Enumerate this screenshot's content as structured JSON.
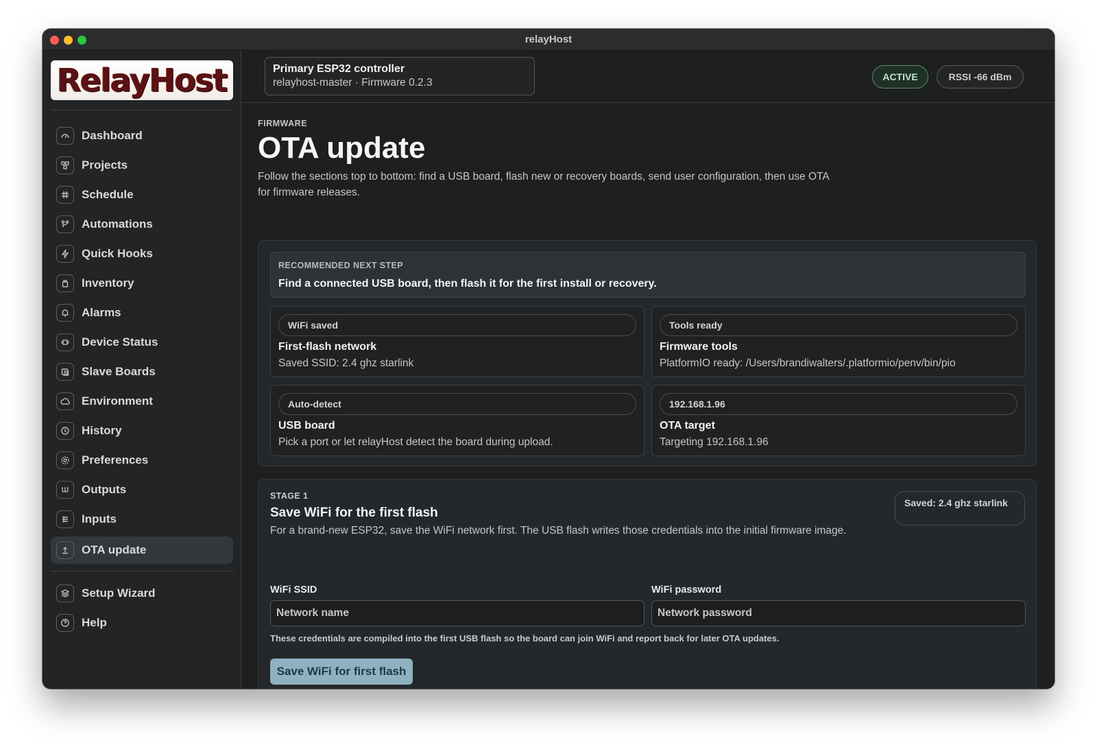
{
  "window": {
    "title": "relayHost"
  },
  "brand": {
    "logo_text": "RelayHost"
  },
  "sidebar": {
    "items": [
      {
        "label": "Dashboard",
        "icon": "gauge-icon"
      },
      {
        "label": "Projects",
        "icon": "projects-icon"
      },
      {
        "label": "Schedule",
        "icon": "calendar-grid-icon"
      },
      {
        "label": "Automations",
        "icon": "flow-icon"
      },
      {
        "label": "Quick Hooks",
        "icon": "lightning-icon"
      },
      {
        "label": "Inventory",
        "icon": "box-icon"
      },
      {
        "label": "Alarms",
        "icon": "bell-icon"
      },
      {
        "label": "Device Status",
        "icon": "chip-icon"
      },
      {
        "label": "Slave Boards",
        "icon": "boards-icon"
      },
      {
        "label": "Environment",
        "icon": "cloud-icon"
      },
      {
        "label": "History",
        "icon": "clock-history-icon"
      },
      {
        "label": "Preferences",
        "icon": "gear-icon"
      },
      {
        "label": "Outputs",
        "icon": "outputs-icon"
      },
      {
        "label": "Inputs",
        "icon": "list-icon"
      },
      {
        "label": "OTA update",
        "icon": "upload-icon",
        "active": true
      }
    ],
    "footer_items": [
      {
        "label": "Setup Wizard",
        "icon": "layers-icon"
      },
      {
        "label": "Help",
        "icon": "help-circle-icon"
      }
    ]
  },
  "header": {
    "device_name": "Primary ESP32 controller",
    "device_sub": "relayhost-master · Firmware 0.2.3",
    "status_badge": "ACTIVE",
    "rssi_badge": "RSSI -66 dBm"
  },
  "page": {
    "eyebrow": "FIRMWARE",
    "title": "OTA update",
    "description": "Follow the sections top to bottom: find a USB board, flash new or recovery boards, send user configuration, then use OTA for firmware releases."
  },
  "overview": {
    "next_step_eyebrow": "RECOMMENDED NEXT STEP",
    "next_step_text": "Find a connected USB board, then flash it for the first install or recovery.",
    "cards": [
      {
        "pill": "WiFi saved",
        "title": "First-flash network",
        "sub": "Saved SSID: 2.4 ghz starlink"
      },
      {
        "pill": "Tools ready",
        "title": "Firmware tools",
        "sub": "PlatformIO ready: /Users/brandiwalters/.platformio/penv/bin/pio"
      },
      {
        "pill": "Auto-detect",
        "title": "USB board",
        "sub": "Pick a port or let relayHost detect the board during upload."
      },
      {
        "pill": "192.168.1.96",
        "title": "OTA target",
        "sub": "Targeting 192.168.1.96"
      }
    ]
  },
  "stage1": {
    "eyebrow": "STAGE 1",
    "title": "Save WiFi for the first flash",
    "description": "For a brand-new ESP32, save the WiFi network first. The USB flash writes those credentials into the initial firmware image.",
    "saved_pill": "Saved: 2.4 ghz starlink",
    "ssid_label": "WiFi SSID",
    "ssid_placeholder": "Network name",
    "password_label": "WiFi password",
    "password_placeholder": "Network password",
    "hint": "These credentials are compiled into the first USB flash so the board can join WiFi and report back for later OTA updates.",
    "save_button": "Save WiFi for first flash"
  }
}
